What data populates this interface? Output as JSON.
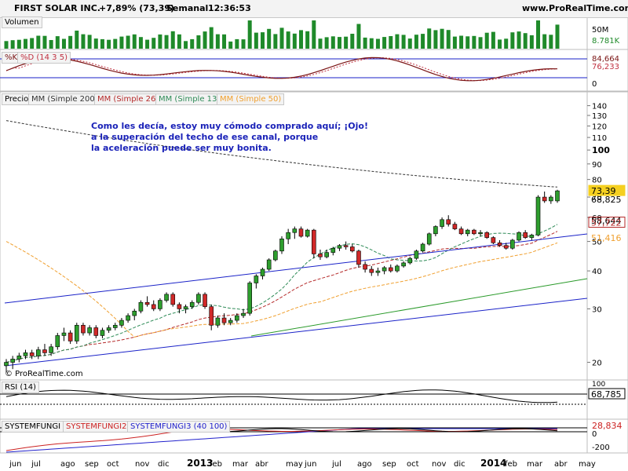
{
  "header": {
    "title": "FIRST SOLAR INC.",
    "change": "+7,89% (73,39)",
    "period": "Semanal",
    "time": "12:36:53",
    "site": "www.ProRealTime.com"
  },
  "panels": {
    "volume": "Volumen",
    "stoch_k": "%K",
    "stoch_d": "%D (14 3 5)",
    "price": "Precio",
    "ma200": "MM (Simple 200)",
    "ma26": "MM (Simple 26)",
    "ma13": "MM (Simple 13)",
    "ma50": "MM (Simple 50)",
    "rsi": "RSI (14)",
    "sys1": "SYSTEMFUNGI",
    "sys2": "SYSTEMFUNGI2",
    "sys3": "SYSTEMFUNGI3 (40 100)"
  },
  "annotation": [
    "Como les decía, estoy muy cómodo comprado aquí; ¡Ojo!",
    "a la superación del techo de ese canal, porque",
    "la aceleración puede ser muy bonita."
  ],
  "copyright": "© ProRealTime.com",
  "colors": {
    "up": "#2e9e2e",
    "down": "#d02828",
    "ma200": "#333333",
    "ma26": "#b52a2a",
    "ma13": "#2e8b57",
    "ma50": "#f0a030",
    "channel": "#1a22c8",
    "support": "#2a9a2a",
    "volume": "#1f8a2a",
    "stoch_k": "#7a1414",
    "stoch_fill_up": "#9a9ad8",
    "stoch_fill_down": "#e8a8b0",
    "rsi_line": "#000000",
    "sys1": "#000000",
    "sys2": "#cc2222",
    "sys3": "#2222cc"
  },
  "chart_data": {
    "type": "candlestick",
    "price_axis": {
      "min": 25,
      "max": 150,
      "scale": "log",
      "ticks": [
        "140",
        "130",
        "120",
        "110",
        "100",
        "90",
        "80",
        "70",
        "60",
        "50",
        "40",
        "30",
        "20"
      ]
    },
    "x_labels": [
      "jun",
      "jul",
      "ago",
      "sep",
      "oct",
      "nov",
      "dic",
      "2013",
      "feb",
      "mar",
      "abr",
      "may",
      "jun",
      "jul",
      "ago",
      "sep",
      "oct",
      "nov",
      "dic",
      "2014",
      "feb",
      "mar",
      "abr",
      "may"
    ],
    "last_values": {
      "close": "73,39",
      "ma50_label": "68,825",
      "ma13_label": "58,644",
      "ma26_label": "57,722",
      "ma50_value": "51,416"
    },
    "candles": [
      [
        19.5,
        20.5,
        18.5,
        20
      ],
      [
        20,
        21,
        19,
        20.5
      ],
      [
        20.5,
        21.5,
        20,
        21
      ],
      [
        21,
        22,
        20.5,
        21.5
      ],
      [
        21.5,
        22,
        20.5,
        21
      ],
      [
        21,
        22.5,
        20.5,
        22
      ],
      [
        22,
        23,
        21,
        21.5
      ],
      [
        21.5,
        23,
        21,
        22.5
      ],
      [
        22.5,
        25,
        22,
        24.5
      ],
      [
        24.5,
        26,
        23.5,
        25
      ],
      [
        25,
        25.5,
        23,
        23.5
      ],
      [
        23.5,
        27,
        23,
        26.5
      ],
      [
        26.5,
        27,
        24.5,
        25
      ],
      [
        25,
        26.5,
        24.5,
        26
      ],
      [
        26,
        26.5,
        24,
        24.5
      ],
      [
        24.5,
        26,
        24,
        25.5
      ],
      [
        25.5,
        26.5,
        25,
        26
      ],
      [
        26,
        27,
        25.5,
        26.5
      ],
      [
        26.5,
        28,
        26,
        27.5
      ],
      [
        27.5,
        29,
        27,
        28.5
      ],
      [
        28.5,
        30,
        27.5,
        29.5
      ],
      [
        29.5,
        32,
        29,
        31.5
      ],
      [
        31.5,
        33,
        30.5,
        31
      ],
      [
        31,
        32,
        29.5,
        30
      ],
      [
        30,
        32.5,
        29.5,
        32
      ],
      [
        32,
        34,
        31.5,
        33.5
      ],
      [
        33.5,
        34,
        30.5,
        31
      ],
      [
        31,
        31.5,
        29,
        30
      ],
      [
        30,
        31,
        29,
        30.5
      ],
      [
        30.5,
        32,
        30,
        31.5
      ],
      [
        31.5,
        34,
        31,
        33.5
      ],
      [
        33.5,
        34,
        30,
        30.5
      ],
      [
        30.5,
        31,
        25.5,
        26.5
      ],
      [
        26.5,
        28.5,
        26,
        28
      ],
      [
        28,
        29,
        26.5,
        27
      ],
      [
        27,
        28,
        26.5,
        27.5
      ],
      [
        27.5,
        29,
        27,
        28.5
      ],
      [
        28.5,
        30,
        28,
        29
      ],
      [
        29,
        37,
        28.5,
        36.5
      ],
      [
        36.5,
        39,
        35,
        38.5
      ],
      [
        38.5,
        41,
        37.5,
        40.5
      ],
      [
        40.5,
        44,
        40,
        43.5
      ],
      [
        43.5,
        47,
        43,
        46.5
      ],
      [
        46.5,
        52,
        45.5,
        51
      ],
      [
        51,
        55,
        49,
        53.5
      ],
      [
        53.5,
        56,
        51,
        55
      ],
      [
        55,
        56,
        51.5,
        52
      ],
      [
        52,
        55,
        51.5,
        54.5
      ],
      [
        54.5,
        55,
        44,
        45.5
      ],
      [
        45.5,
        47,
        43.5,
        44.5
      ],
      [
        44.5,
        47,
        44,
        46
      ],
      [
        46,
        48,
        45,
        47.5
      ],
      [
        47.5,
        49,
        46.5,
        48.5
      ],
      [
        48.5,
        50,
        47,
        48
      ],
      [
        48,
        49,
        46,
        46.5
      ],
      [
        46.5,
        47,
        41,
        42
      ],
      [
        42,
        43,
        39.5,
        40.5
      ],
      [
        40.5,
        41.5,
        38.5,
        39.5
      ],
      [
        39.5,
        41,
        38.5,
        40
      ],
      [
        40,
        41.5,
        39,
        41
      ],
      [
        41,
        42,
        39.5,
        40
      ],
      [
        40,
        42,
        39.5,
        41.5
      ],
      [
        41.5,
        43,
        41,
        42.5
      ],
      [
        42.5,
        44.5,
        42,
        44
      ],
      [
        44,
        47,
        43.5,
        46.5
      ],
      [
        46.5,
        49.5,
        46,
        49
      ],
      [
        49,
        53.5,
        48.5,
        53
      ],
      [
        53,
        56.5,
        52,
        56
      ],
      [
        56,
        60,
        55,
        59
      ],
      [
        59,
        61,
        56,
        57
      ],
      [
        57,
        58,
        54.5,
        55
      ],
      [
        55,
        56,
        52.5,
        53
      ],
      [
        53,
        55,
        52,
        54.5
      ],
      [
        54.5,
        55,
        52.5,
        53
      ],
      [
        53,
        54.5,
        52,
        53.5
      ],
      [
        53.5,
        54,
        51,
        51.5
      ],
      [
        51.5,
        52,
        49,
        49.5
      ],
      [
        49.5,
        50.5,
        48,
        48.5
      ],
      [
        48.5,
        49.5,
        47,
        47.5
      ],
      [
        47.5,
        51,
        47,
        50.5
      ],
      [
        50.5,
        54,
        50,
        53.5
      ],
      [
        53.5,
        54.5,
        51,
        51.5
      ],
      [
        51.5,
        53,
        50.5,
        52.5
      ],
      [
        52.5,
        71,
        52,
        70
      ],
      [
        70,
        73,
        67,
        68
      ],
      [
        68,
        71,
        66.5,
        70
      ],
      [
        68,
        74,
        67,
        73.39
      ]
    ]
  }
}
